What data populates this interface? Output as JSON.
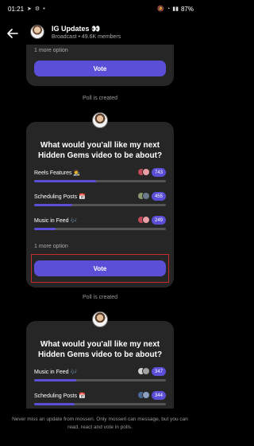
{
  "status_bar": {
    "time": "01:21",
    "left_icons": [
      "telegram-icon",
      "gear-icon",
      "dot"
    ],
    "battery": "87%"
  },
  "header": {
    "title": "IG Updates 👀",
    "subtitle": "Broadcast • 49.6K members"
  },
  "prev_poll": {
    "more_option": "1 more option",
    "vote_label": "Vote"
  },
  "divider_1": "Poll is created",
  "poll_main": {
    "question": "What would you'all like my next Hidden Gems video to be about?",
    "options": [
      {
        "label": "Reels Features 🧑‍🎨",
        "count": "743",
        "share": 0.47
      },
      {
        "label": "Scheduling Posts 📅",
        "count": "455",
        "share": 0.29
      },
      {
        "label": "Music in Feed 🎶",
        "count": "249",
        "share": 0.16
      }
    ],
    "more_option": "1 more option",
    "vote_label": "Vote"
  },
  "divider_2": "Poll is created",
  "poll_next": {
    "question": "What would you'all like my next Hidden Gems video to be about?",
    "options": [
      {
        "label": "Music in Feed 🎶",
        "count": "347",
        "share": 0.32
      },
      {
        "label": "Scheduling Posts 📅",
        "count": "344",
        "share": 0.31
      }
    ]
  },
  "footer": "Never miss an update from mosseri. Only mosseri can message, but you can read, react and vote in polls.",
  "colors": {
    "accent": "#5a4fd6",
    "card": "#262626",
    "highlight": "#c92a2a"
  }
}
